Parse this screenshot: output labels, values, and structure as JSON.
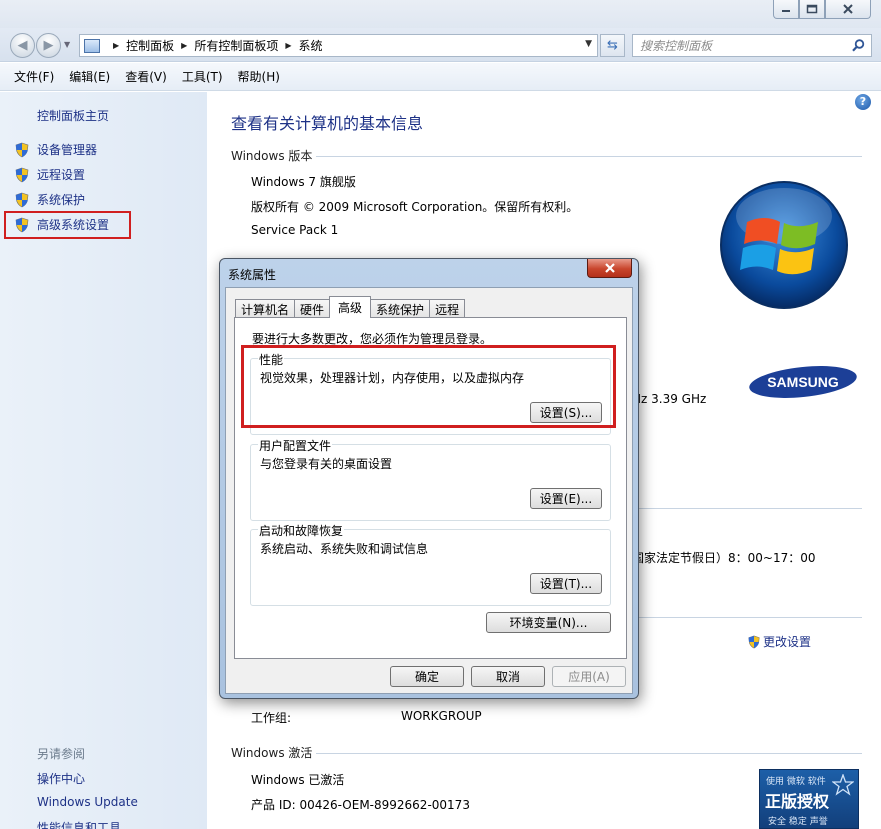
{
  "window": {
    "caption_icons": [
      "minimize-icon",
      "maximize-icon",
      "close-icon"
    ]
  },
  "nav": {
    "breadcrumb": [
      "控制面板",
      "所有控制面板项",
      "系统"
    ],
    "search_placeholder": "搜索控制面板"
  },
  "menu": [
    "文件(F)",
    "编辑(E)",
    "查看(V)",
    "工具(T)",
    "帮助(H)"
  ],
  "left": {
    "home": "控制面板主页",
    "items": [
      "设备管理器",
      "远程设置",
      "系统保护",
      "高级系统设置"
    ],
    "see_also": "另请参阅",
    "see_also_links": [
      "操作中心",
      "Windows Update",
      "性能信息和工具"
    ]
  },
  "main": {
    "title": "查看有关计算机的基本信息",
    "edition_header": "Windows 版本",
    "edition": "Windows 7 旗舰版",
    "copyright": "版权所有 © 2009 Microsoft Corporation。保留所有权利。",
    "service_pack": "Service Pack 1",
    "cpu_partial": "Hz   3.39 GHz",
    "support_hours_partial": "国家法定节假日）8：00~17：00",
    "change_settings": "更改设置",
    "workgroup_label": "工作组:",
    "workgroup_value": "WORKGROUP",
    "activation_header": "Windows 激活",
    "activated": "Windows 已激活",
    "product_id": "产品 ID: 00426-OEM-8992662-00173",
    "genuine_top": "使用 微软 软件",
    "genuine_main": "正版授权",
    "genuine_sub": "安全 稳定 声誉",
    "oem_brand": "SAMSUNG"
  },
  "dialog": {
    "title": "系统属性",
    "tabs": [
      "计算机名",
      "硬件",
      "高级",
      "系统保护",
      "远程"
    ],
    "active_tab": "高级",
    "admin_note": "要进行大多数更改，您必须作为管理员登录。",
    "performance": {
      "label": "性能",
      "text": "视觉效果，处理器计划，内存使用，以及虚拟内存",
      "button": "设置(S)..."
    },
    "profiles": {
      "label": "用户配置文件",
      "text": "与您登录有关的桌面设置",
      "button": "设置(E)..."
    },
    "startup": {
      "label": "启动和故障恢复",
      "text": "系统启动、系统失败和调试信息",
      "button": "设置(T)..."
    },
    "env_button": "环境变量(N)...",
    "ok": "确定",
    "cancel": "取消",
    "apply": "应用(A)"
  }
}
